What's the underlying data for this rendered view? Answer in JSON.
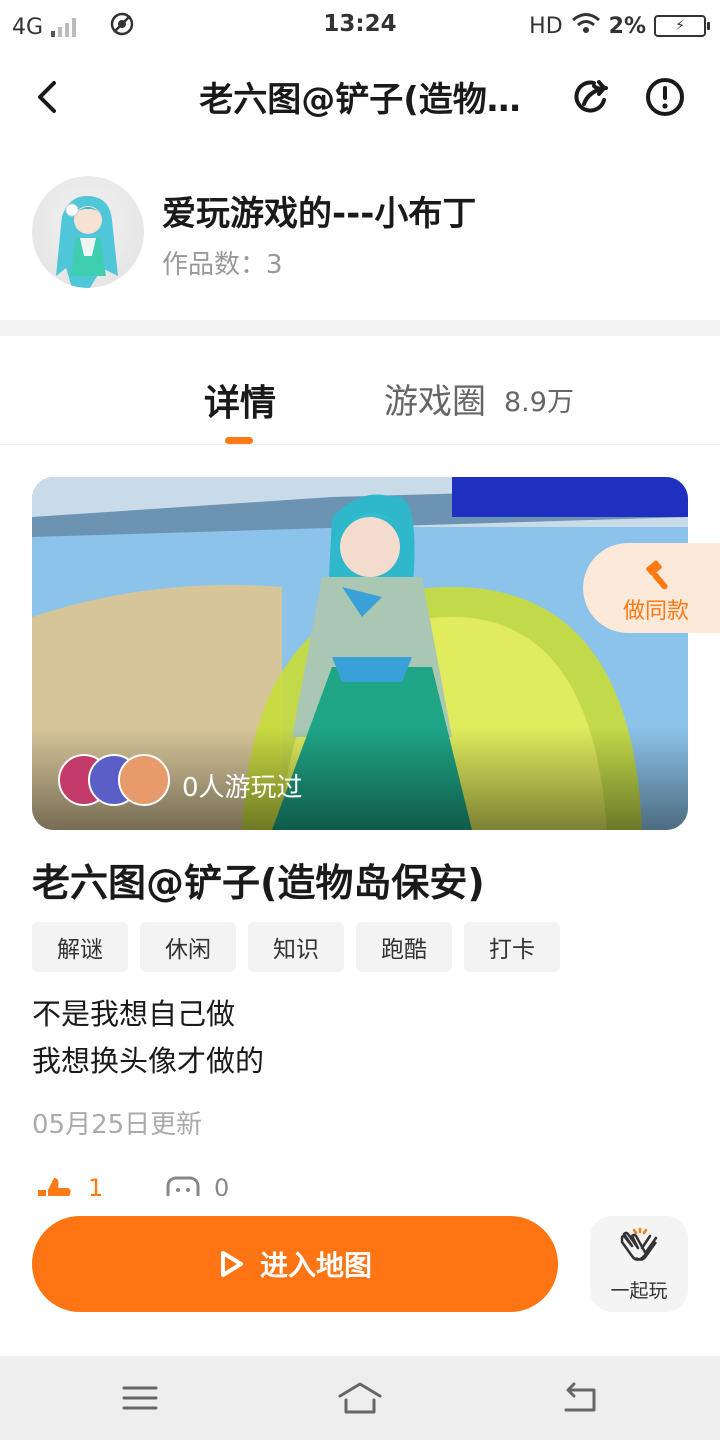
{
  "status_bar": {
    "network": "4G",
    "time": "13:24",
    "hd": "HD",
    "battery_percent": "2%"
  },
  "header": {
    "title": "老六图@铲子(造物…",
    "back_icon": "chevron-left-icon",
    "share_icon": "share-icon",
    "report_icon": "alert-circle-icon"
  },
  "author": {
    "name": "爱玩游戏的---小布丁",
    "works_count": "作品数：3"
  },
  "tabs": {
    "detail": "详情",
    "circle": "游戏圈",
    "circle_count": "8.9万"
  },
  "cover": {
    "played_text": "0人游玩过",
    "make_same_label": "做同款"
  },
  "work": {
    "title": "老六图@铲子(造物岛保安)",
    "tags": [
      "解谜",
      "休闲",
      "知识",
      "跑酷",
      "打卡"
    ],
    "description": [
      "不是我想自己做",
      "我想换头像才做的"
    ],
    "updated": "05月25日更新",
    "likes": "1",
    "comments": "0"
  },
  "actions": {
    "enter_map": "进入地图",
    "play_together": "一起玩"
  },
  "colors": {
    "accent": "#ff7514",
    "accent_light": "#fde9d9",
    "tag_bg": "#f3f3f3"
  }
}
